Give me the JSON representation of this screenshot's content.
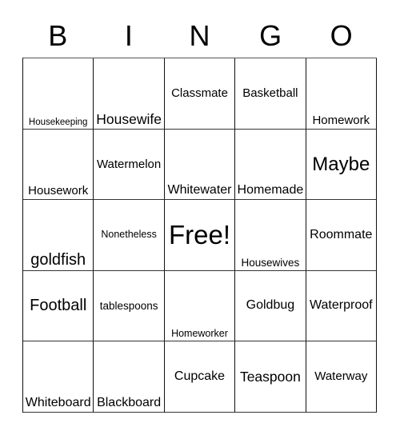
{
  "card": {
    "header_letters": [
      "B",
      "I",
      "N",
      "G",
      "O"
    ],
    "grid": {
      "rows": 5,
      "columns": 5,
      "cells": [
        {
          "label": "Housekeeping",
          "size": "fs-11",
          "align": "va-bottom"
        },
        {
          "label": "Housewife",
          "size": "fs-17",
          "align": "va-bottom"
        },
        {
          "label": "Classmate",
          "size": "fs-15",
          "align": "va-middle"
        },
        {
          "label": "Basketball",
          "size": "fs-15",
          "align": "va-middle"
        },
        {
          "label": "Homework",
          "size": "fs-15",
          "align": "va-bottom"
        },
        {
          "label": "Housework",
          "size": "fs-15",
          "align": "va-bottom"
        },
        {
          "label": "Watermelon",
          "size": "fs-15",
          "align": "va-middle"
        },
        {
          "label": "Whitewater",
          "size": "fs-14",
          "align": "va-bottom"
        },
        {
          "label": "Homemade",
          "size": "fs-14",
          "align": "va-bottom"
        },
        {
          "label": "Maybe",
          "size": "fs-24",
          "align": "va-middle"
        },
        {
          "label": "goldfish",
          "size": "fs-20",
          "align": "va-bottom"
        },
        {
          "label": "Nonetheless",
          "size": "fs-12",
          "align": "va-middle"
        },
        {
          "label": "Free!",
          "size": "fs-32",
          "align": "va-middle"
        },
        {
          "label": "Housewives",
          "size": "fs-13",
          "align": "va-bottom"
        },
        {
          "label": "Roommate",
          "size": "fs-14",
          "align": "va-middle"
        },
        {
          "label": "Football",
          "size": "fs-20",
          "align": "va-middle"
        },
        {
          "label": "tablespoons",
          "size": "fs-13",
          "align": "va-middle"
        },
        {
          "label": "Homeworker",
          "size": "fs-12",
          "align": "va-bottom"
        },
        {
          "label": "Goldbug",
          "size": "fs-19",
          "align": "va-middle"
        },
        {
          "label": "Waterproof",
          "size": "fs-14",
          "align": "va-middle"
        },
        {
          "label": "Whiteboard",
          "size": "fs-14",
          "align": "va-bottom"
        },
        {
          "label": "Blackboard",
          "size": "fs-14",
          "align": "va-bottom"
        },
        {
          "label": "Cupcake",
          "size": "fs-19",
          "align": "va-middle"
        },
        {
          "label": "Teaspoon",
          "size": "fs-17",
          "align": "va-middle"
        },
        {
          "label": "Waterway",
          "size": "fs-15",
          "align": "va-middle"
        }
      ]
    },
    "colors": {
      "background": "#ffffff",
      "text": "#000000",
      "grid_line": "#111111"
    }
  }
}
